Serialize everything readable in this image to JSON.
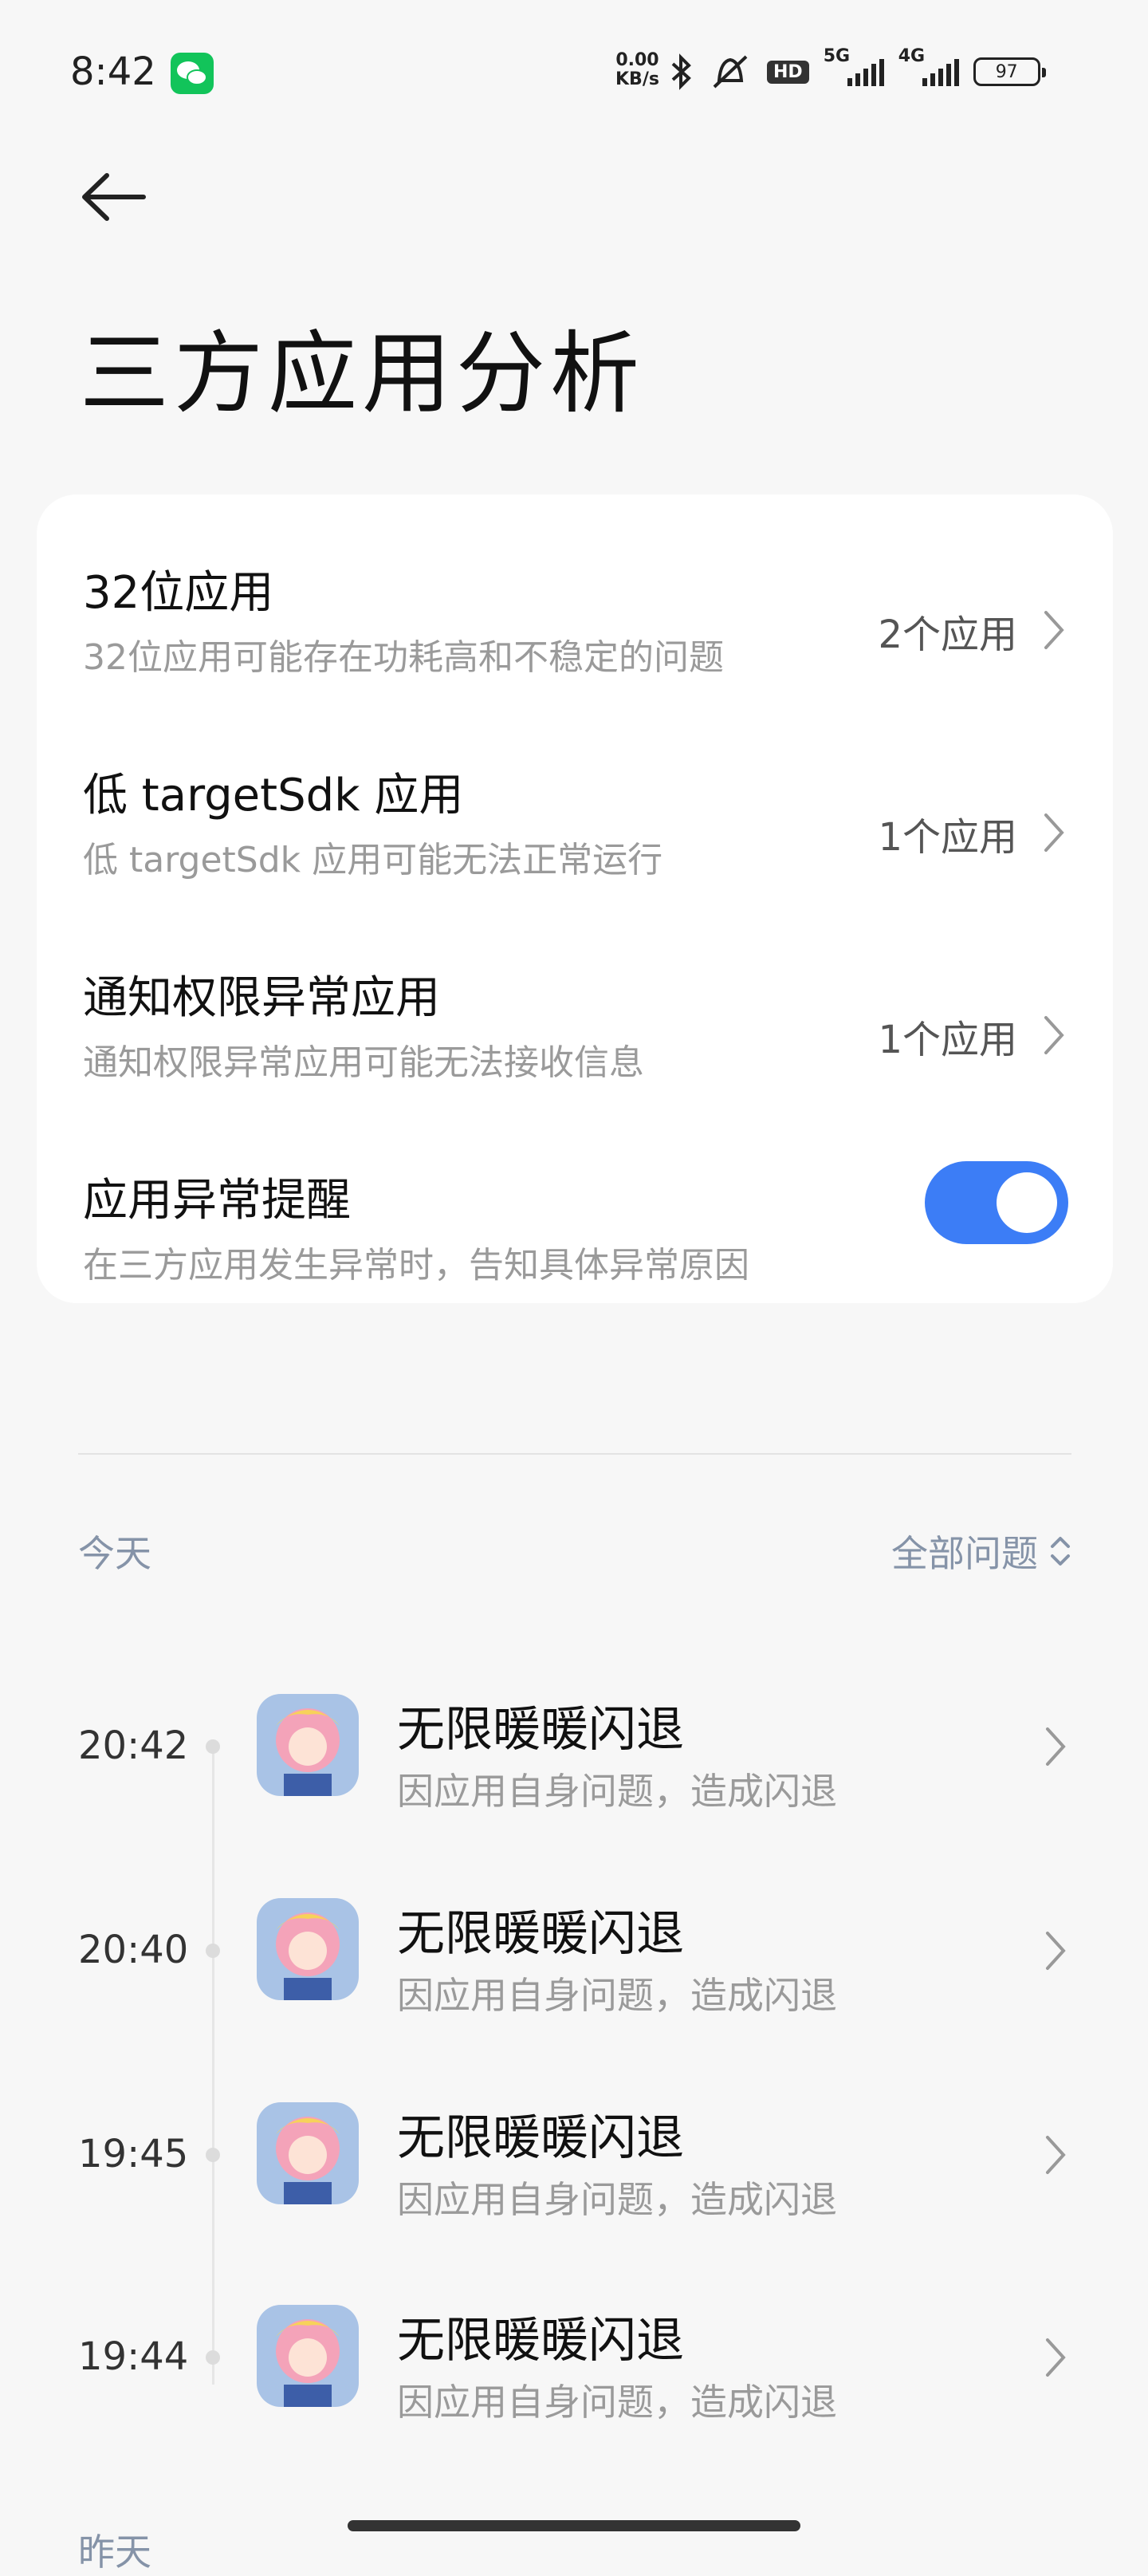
{
  "status_bar": {
    "time": "8:42",
    "net_speed_value": "0.00",
    "net_speed_unit": "KB/s",
    "hd_label": "HD",
    "net1": "5G",
    "net2": "4G",
    "battery": "97",
    "icons": [
      "wechat-icon",
      "bluetooth-icon",
      "mute-icon",
      "signal-icon",
      "battery-icon"
    ]
  },
  "header": {
    "title": "三方应用分析"
  },
  "settings": [
    {
      "title": "32位应用",
      "subtitle": "32位应用可能存在功耗高和不稳定的问题",
      "value": "2个应用"
    },
    {
      "title": "低 targetSdk 应用",
      "subtitle": "低 targetSdk 应用可能无法正常运行",
      "value": "1个应用"
    },
    {
      "title": "通知权限异常应用",
      "subtitle": "通知权限异常应用可能无法接收信息",
      "value": "1个应用"
    }
  ],
  "toggle_item": {
    "title": "应用异常提醒",
    "subtitle": "在三方应用发生异常时，告知具体异常原因",
    "enabled": true
  },
  "log": {
    "section_label": "今天",
    "filter_label": "全部问题",
    "events": [
      {
        "time": "20:42",
        "title": "无限暖暖闪退",
        "reason": "因应用自身问题，造成闪退"
      },
      {
        "time": "20:40",
        "title": "无限暖暖闪退",
        "reason": "因应用自身问题，造成闪退"
      },
      {
        "time": "19:45",
        "title": "无限暖暖闪退",
        "reason": "因应用自身问题，造成闪退"
      },
      {
        "time": "19:44",
        "title": "无限暖暖闪退",
        "reason": "因应用自身问题，造成闪退"
      }
    ],
    "next_section_label": "昨天"
  },
  "colors": {
    "accent": "#3c7df6",
    "muted_label": "#8593a8",
    "background": "#f7f7f7"
  }
}
